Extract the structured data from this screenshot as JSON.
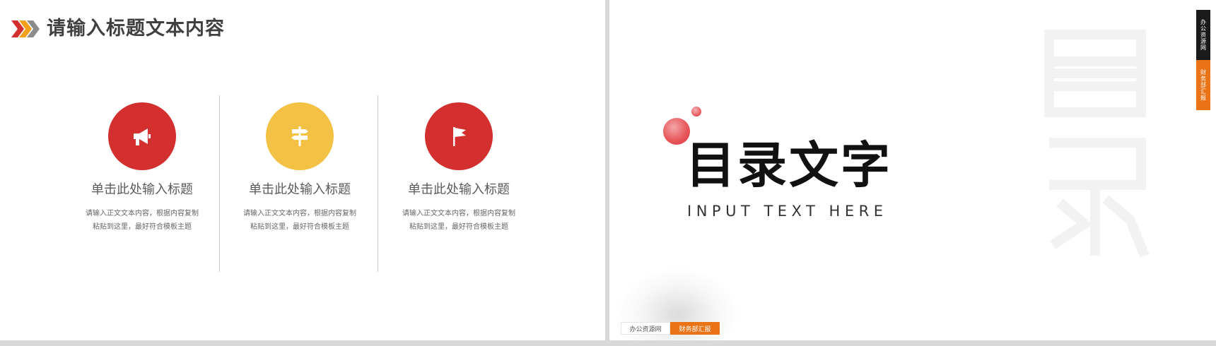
{
  "left_slide": {
    "title": "请输入标题文本内容",
    "items": [
      {
        "title": "单击此处输入标题",
        "desc_line1": "请输入正文文本内容，根据内容复制",
        "desc_line2": "粘贴到这里，最好符合模板主题",
        "icon": "megaphone-icon",
        "color": "#d32f2f"
      },
      {
        "title": "单击此处输入标题",
        "desc_line1": "请输入正文文本内容，根据内容复制",
        "desc_line2": "粘贴到这里，最好符合模板主题",
        "icon": "signpost-icon",
        "color": "#f3c244"
      },
      {
        "title": "单击此处输入标题",
        "desc_line1": "请输入正文文本内容，根据内容复制",
        "desc_line2": "粘贴到这里，最好符合模板主题",
        "icon": "flag-icon",
        "color": "#d32f2f"
      }
    ],
    "chevron_colors": [
      "#d32f2f",
      "#f3a01c",
      "#8c8c8c"
    ]
  },
  "right_slide": {
    "title": "目录文字",
    "subtitle": "INPUT TEXT HERE",
    "watermark": "目录",
    "side_badge_dark": "办公资源网",
    "side_badge_orange": "财务部汇报",
    "footer_left": "办公资源网",
    "footer_right": "财务部汇报",
    "accent_color": "#ea7317"
  }
}
